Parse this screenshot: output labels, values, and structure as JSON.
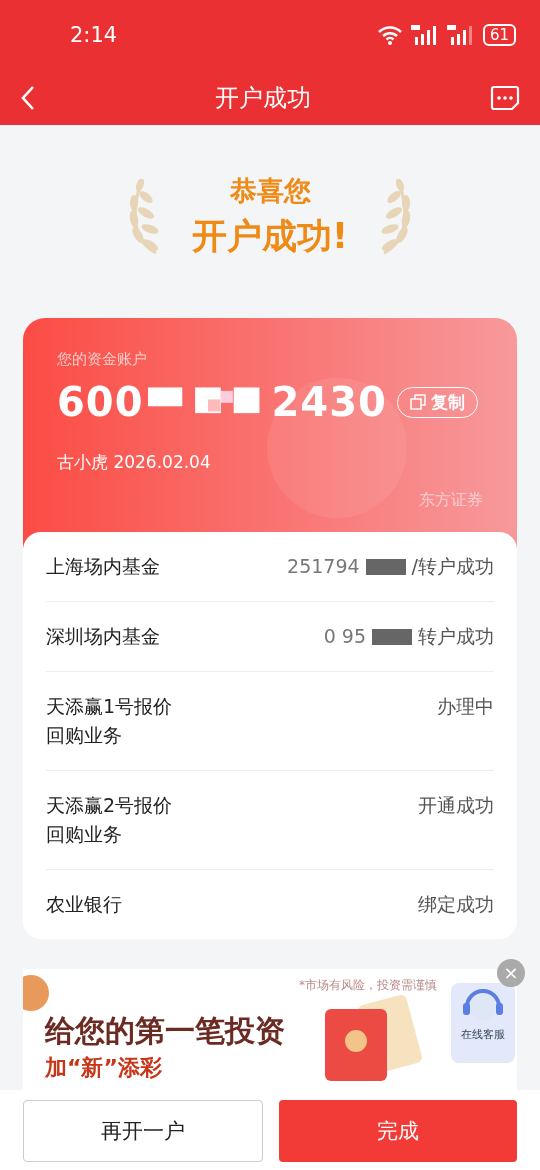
{
  "status_bar": {
    "time": "2:14",
    "battery": "61"
  },
  "nav": {
    "title": "开户成功"
  },
  "congrats": {
    "line_1": "恭喜您",
    "line_2": "开户成功!"
  },
  "account_card": {
    "label": "您的资金账户",
    "number_start": "600",
    "number_end": "2430",
    "copy_button": "复制",
    "owner_date": "古小虎 2026.02.04",
    "brand": "东方证券"
  },
  "rows": [
    {
      "name": "上海场内基金",
      "masked_prefix": "251794",
      "status": "/转户成功"
    },
    {
      "name": "深圳场内基金",
      "masked_prefix": "0 95",
      "status": "转户成功"
    },
    {
      "name": "天添赢1号报价回购业务",
      "status": "办理中"
    },
    {
      "name": "天添赢2号报价回购业务",
      "status": "开通成功"
    },
    {
      "name": "农业银行",
      "status": "绑定成功"
    }
  ],
  "banner": {
    "disclaimer": "*市场有风险，投资需谨慎",
    "headline": "给您的第一笔投资",
    "subline": "加“新”添彩",
    "close": "×"
  },
  "support": {
    "label": "在线客服"
  },
  "buttons": [
    {
      "label": "再开一户",
      "kind": "secondary"
    },
    {
      "label": "完成",
      "kind": "primary"
    }
  ]
}
